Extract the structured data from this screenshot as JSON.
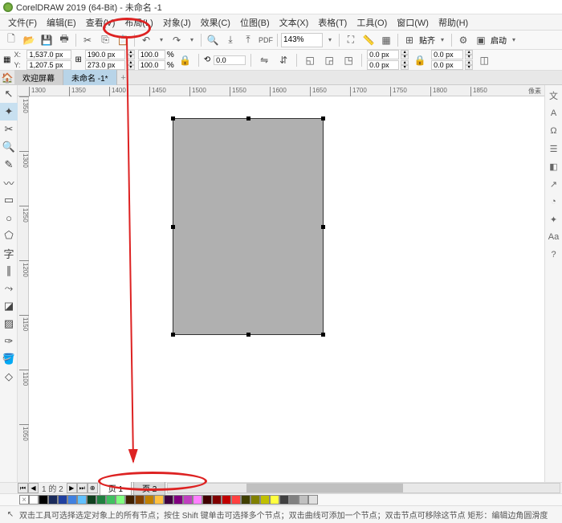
{
  "title": "CorelDRAW 2019 (64-Bit) - 未命名 -1",
  "menu": {
    "file": "文件(F)",
    "edit": "编辑(E)",
    "view": "查看(V)",
    "layout": "布局(L)",
    "object": "对象(J)",
    "effects": "效果(C)",
    "bitmap": "位图(B)",
    "text": "文本(X)",
    "table": "表格(T)",
    "tools": "工具(O)",
    "window": "窗口(W)",
    "help": "帮助(H)"
  },
  "toolbar": {
    "zoom": "143%",
    "paste_label": "贴齐",
    "launch_label": "启动"
  },
  "props": {
    "x_label": "X:",
    "x": "1,537.0 px",
    "y_label": "Y:",
    "y": "1,207.5 px",
    "w": "190.0 px",
    "h": "273.0 px",
    "sx": "100.0",
    "sy": "100.0",
    "pct": "%",
    "rotation": "0.0",
    "ol1": "0.0 px",
    "ol2": "0.0 px",
    "ol3": "0.0 px",
    "ol4": "0.0 px"
  },
  "tabs": {
    "welcome": "欢迎屏幕",
    "doc": "未命名 -1*",
    "new": "+"
  },
  "ruler_h": [
    "1300",
    "1350",
    "1400",
    "1450",
    "1500",
    "1550",
    "1600",
    "1650",
    "1700",
    "1750",
    "1800",
    "1850"
  ],
  "ruler_h_unit": "像素",
  "ruler_v": [
    "1350",
    "1300",
    "1250",
    "1200",
    "1150",
    "1100",
    "1050"
  ],
  "pagenav": {
    "info": "1 的 2",
    "plus": "+",
    "page1": "页 1",
    "page2": "页 2"
  },
  "colors": [
    "#ffffff",
    "#000000",
    "#1a2a5a",
    "#2040a0",
    "#4080e0",
    "#60c0ff",
    "#104020",
    "#208040",
    "#40c060",
    "#80ff80",
    "#402000",
    "#804000",
    "#c08000",
    "#ffc040",
    "#400040",
    "#800080",
    "#c040c0",
    "#ff80ff",
    "#400000",
    "#800000",
    "#c00000",
    "#ff4040",
    "#404000",
    "#808000",
    "#c0c000",
    "#ffff40",
    "#404040",
    "#808080",
    "#c0c0c0",
    "#e0e0e0"
  ],
  "status": "双击工具可选择选定对象上的所有节点；按住 Shift 键单击可选择多个节点；双击曲线可添加一个节点；双击节点可移除这节点    矩形：编辑边角圆滑度"
}
